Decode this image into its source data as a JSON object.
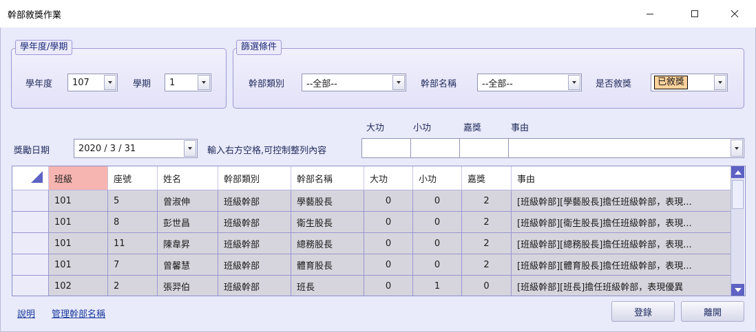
{
  "window": {
    "title": "幹部敘獎作業"
  },
  "term_group": {
    "title": "學年度/學期",
    "year_label": "學年度",
    "year_value": "107",
    "semester_label": "學期",
    "semester_value": "1"
  },
  "filter_group": {
    "title": "篩選條件",
    "type_label": "幹部類別",
    "type_value": "--全部--",
    "name_label": "幹部名稱",
    "name_value": "--全部--",
    "awarded_label": "是否敘獎",
    "awarded_value": "已敘獎"
  },
  "award_date": {
    "label": "獎勵日期",
    "value": "2020 / 3 / 31",
    "hint": "輸入右方空格,可控制整列內容",
    "col_merit": "大功",
    "col_minor": "小功",
    "col_commend": "嘉獎",
    "col_reason": "事由"
  },
  "grid": {
    "columns": [
      "班級",
      "座號",
      "姓名",
      "幹部類別",
      "幹部名稱",
      "大功",
      "小功",
      "嘉獎",
      "事由"
    ],
    "rows": [
      [
        "101",
        "5",
        "曾淑伸",
        "班級幹部",
        "學藝股長",
        "0",
        "0",
        "2",
        "[班級幹部][學藝股長]擔任班級幹部，表現..."
      ],
      [
        "101",
        "8",
        "彭世昌",
        "班級幹部",
        "衛生股長",
        "0",
        "0",
        "2",
        "[班級幹部][衛生股長]擔任班級幹部，表現..."
      ],
      [
        "101",
        "11",
        "陳韋昇",
        "班級幹部",
        "總務股長",
        "0",
        "0",
        "2",
        "[班級幹部][總務股長]擔任班級幹部，表現..."
      ],
      [
        "101",
        "7",
        "曾馨慧",
        "班級幹部",
        "體育股長",
        "0",
        "0",
        "2",
        "[班級幹部][體育股長]擔任班級幹部，表現..."
      ],
      [
        "102",
        "2",
        "張羿伯",
        "班級幹部",
        "班長",
        "0",
        "1",
        "0",
        "[班級幹部][班長]擔任班級幹部，表現優異"
      ]
    ]
  },
  "footer": {
    "help_link": "說明",
    "manage_link": "管理幹部名稱",
    "register_button": "登錄",
    "leave_button": "離開"
  },
  "colors": {
    "accent": "#5d62c3",
    "sorted_header": "#f6b5b0",
    "awarded_highlight": "#ffd39c"
  }
}
